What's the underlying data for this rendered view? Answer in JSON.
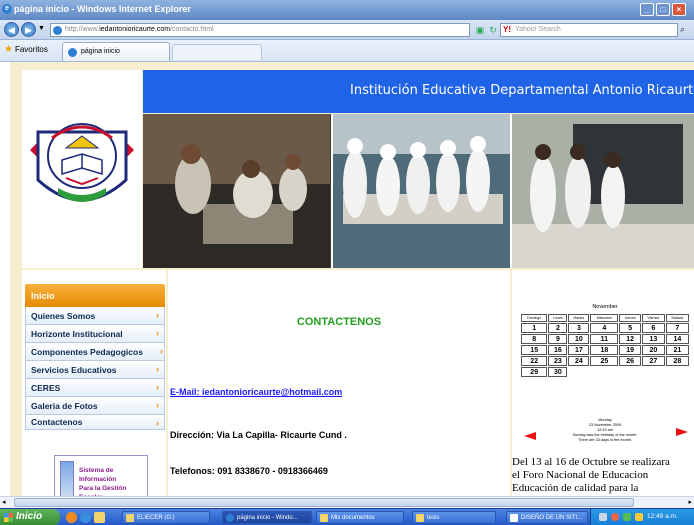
{
  "window": {
    "title": "página inicio - Windows Internet Explorer",
    "controls": [
      "minimize",
      "maximize",
      "close"
    ]
  },
  "toolbar": {
    "back_icon": "back-arrow-icon",
    "forward_icon": "forward-arrow-icon",
    "url_prefix": "http://www.",
    "url_domain": "iedantonioricaurte.com",
    "url_path": "/contacto.html",
    "search_placeholder": "Yahoo! Search",
    "search_brand": "Y!"
  },
  "favorites": {
    "label": "Favoritos",
    "tab_label": "página inicio"
  },
  "site": {
    "banner_title": "Institución Educativa Departamental Antonio Ricaurte",
    "menu": {
      "header": "Inicio",
      "items": [
        "Quienes Somos",
        "Horizonte Institucional",
        "Componentes Pedagogicos",
        "Servicios Educativos",
        "CERES",
        "Galeria de Fotos",
        "Contactenos"
      ]
    },
    "sig_banner": {
      "line1": "Sistema de Información",
      "line2": "Para la Gestión Escolar"
    },
    "contact": {
      "title": "CONTACTENOS",
      "email": "E-Mail: iedantonioricaurte@hotmail.com",
      "address": "Dirección: Via La Capilla- Ricaurte Cund .",
      "phones": "Telefonos: 091 8338670 - 0918366469"
    },
    "calendar": {
      "month": "November",
      "days": [
        "Domingo",
        "Lunes",
        "Martes",
        "Miercoles",
        "Jueves",
        "Viernes",
        "Sabado"
      ],
      "weeks": [
        [
          "1",
          "2",
          "3",
          "4",
          "5",
          "6",
          "7"
        ],
        [
          "8",
          "9",
          "10",
          "11",
          "12",
          "13",
          "14"
        ],
        [
          "15",
          "16",
          "17",
          "18",
          "19",
          "20",
          "21"
        ],
        [
          "22",
          "23",
          "24",
          "25",
          "26",
          "27",
          "28"
        ],
        [
          "29",
          "30",
          "",
          "",
          "",
          "",
          ""
        ]
      ],
      "note1": "Monday",
      "note2": "23 November 2009",
      "note3": "12:49 am",
      "note4": "Sunday was the birthday of the month.",
      "note5": "There are 33 days in the month."
    },
    "news": {
      "line1": "Del 13 al 16 de Octubre se realizara",
      "line2": "el Foro Nacional de Educacion",
      "line3": "Educación de calidad para la"
    }
  },
  "taskbar": {
    "start_label": "Inicio",
    "tasks": [
      "ELIECER (G:)",
      "página inicio - Windo...",
      "Mis documentos",
      "tesis",
      "DISEÑO DE UN SITI..."
    ],
    "clock": "12:49 a.m."
  }
}
